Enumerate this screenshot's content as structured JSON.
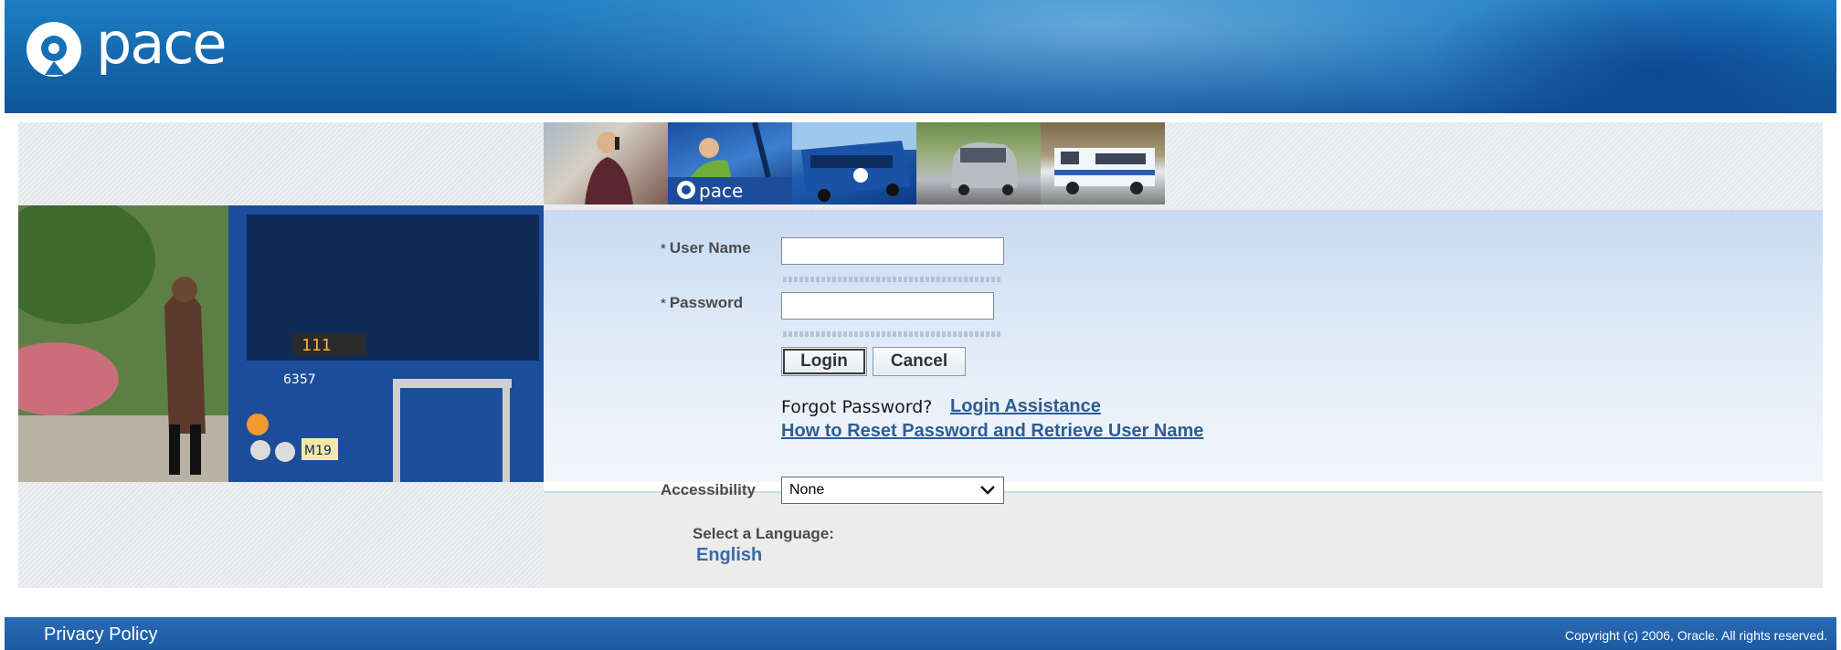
{
  "header": {
    "brand_name": "pace",
    "colors": {
      "header_blue": "#1566ab",
      "footer_blue": "#1c5aa3",
      "link_blue": "#2f5c92"
    }
  },
  "photo_strip": {
    "images": [
      {
        "name": "woman-on-phone-photo"
      },
      {
        "name": "driver-in-bus-photo",
        "logo_text": "pace"
      },
      {
        "name": "blue-bus-photo"
      },
      {
        "name": "silver-minivan-photo"
      },
      {
        "name": "paratransit-van-photo"
      }
    ]
  },
  "hero": {
    "name": "woman-boarding-bus-photo",
    "bus_number": "6357",
    "route_sign": "111",
    "plate": "M19"
  },
  "login_form": {
    "required_marker": "*",
    "username_label": "User Name",
    "username_value": "",
    "password_label": "Password",
    "password_value": "",
    "login_button": "Login",
    "cancel_button": "Cancel",
    "forgot_text": "Forgot Password?",
    "login_assistance_link": "Login Assistance",
    "reset_link": "How to Reset Password and Retrieve User Name",
    "accessibility_label": "Accessibility",
    "accessibility_value": "None"
  },
  "language": {
    "title": "Select a Language:",
    "english_link": "English"
  },
  "footer": {
    "privacy_link": "Privacy Policy",
    "copyright": "Copyright (c) 2006, Oracle. All rights reserved."
  }
}
